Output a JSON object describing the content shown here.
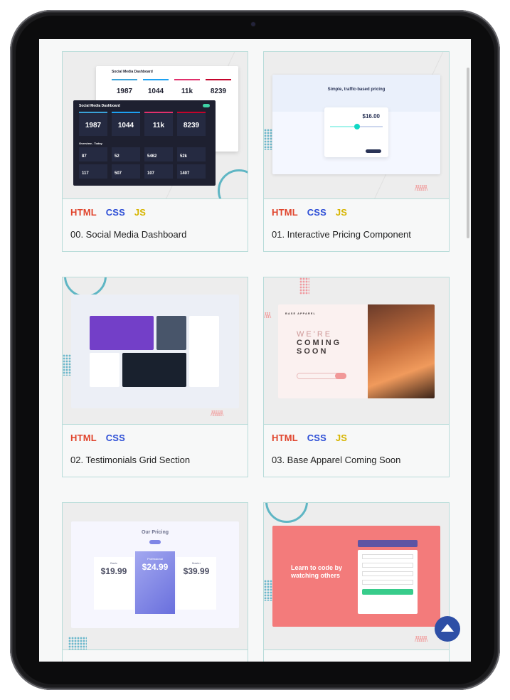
{
  "projects": [
    {
      "title": "00. Social Media Dashboard",
      "tags": [
        "HTML",
        "CSS",
        "JS"
      ]
    },
    {
      "title": "01. Interactive Pricing Component",
      "tags": [
        "HTML",
        "CSS",
        "JS"
      ]
    },
    {
      "title": "02. Testimonials Grid Section",
      "tags": [
        "HTML",
        "CSS"
      ]
    },
    {
      "title": "03. Base Apparel Coming Soon",
      "tags": [
        "HTML",
        "CSS",
        "JS"
      ]
    },
    {
      "title": "",
      "tags": []
    },
    {
      "title": "",
      "tags": []
    }
  ],
  "thumbs": {
    "dashboard": {
      "light_title": "Social Media Dashboard",
      "dark_title": "Social Media Dashboard",
      "values": [
        "1987",
        "1044",
        "11k",
        "8239"
      ],
      "overview": "Overview - Today",
      "overview_values": [
        "87",
        "52",
        "5462",
        "52k",
        "117",
        "507",
        "107",
        "1407"
      ]
    },
    "pricing": {
      "heading": "Simple, traffic-based pricing",
      "price": "$16.00"
    },
    "coming_soon": {
      "brand": "BASE APPAREL",
      "headline_1": "WE'RE",
      "headline_2": "COMING",
      "headline_3": "SOON"
    },
    "our_pricing": {
      "heading": "Our Pricing",
      "prices": [
        "$19.99",
        "$24.99",
        "$39.99"
      ],
      "plans": [
        "Basic",
        "Professional",
        "Master"
      ]
    },
    "learn_code": {
      "heading_1": "Learn to code by",
      "heading_2": "watching others"
    }
  },
  "colors": {
    "html": "#e0452d",
    "css": "#2e4fd6",
    "js": "#d7b500",
    "accent": "#2e4fa6"
  },
  "icons": {
    "back_to_top": "arrow-up-icon"
  }
}
